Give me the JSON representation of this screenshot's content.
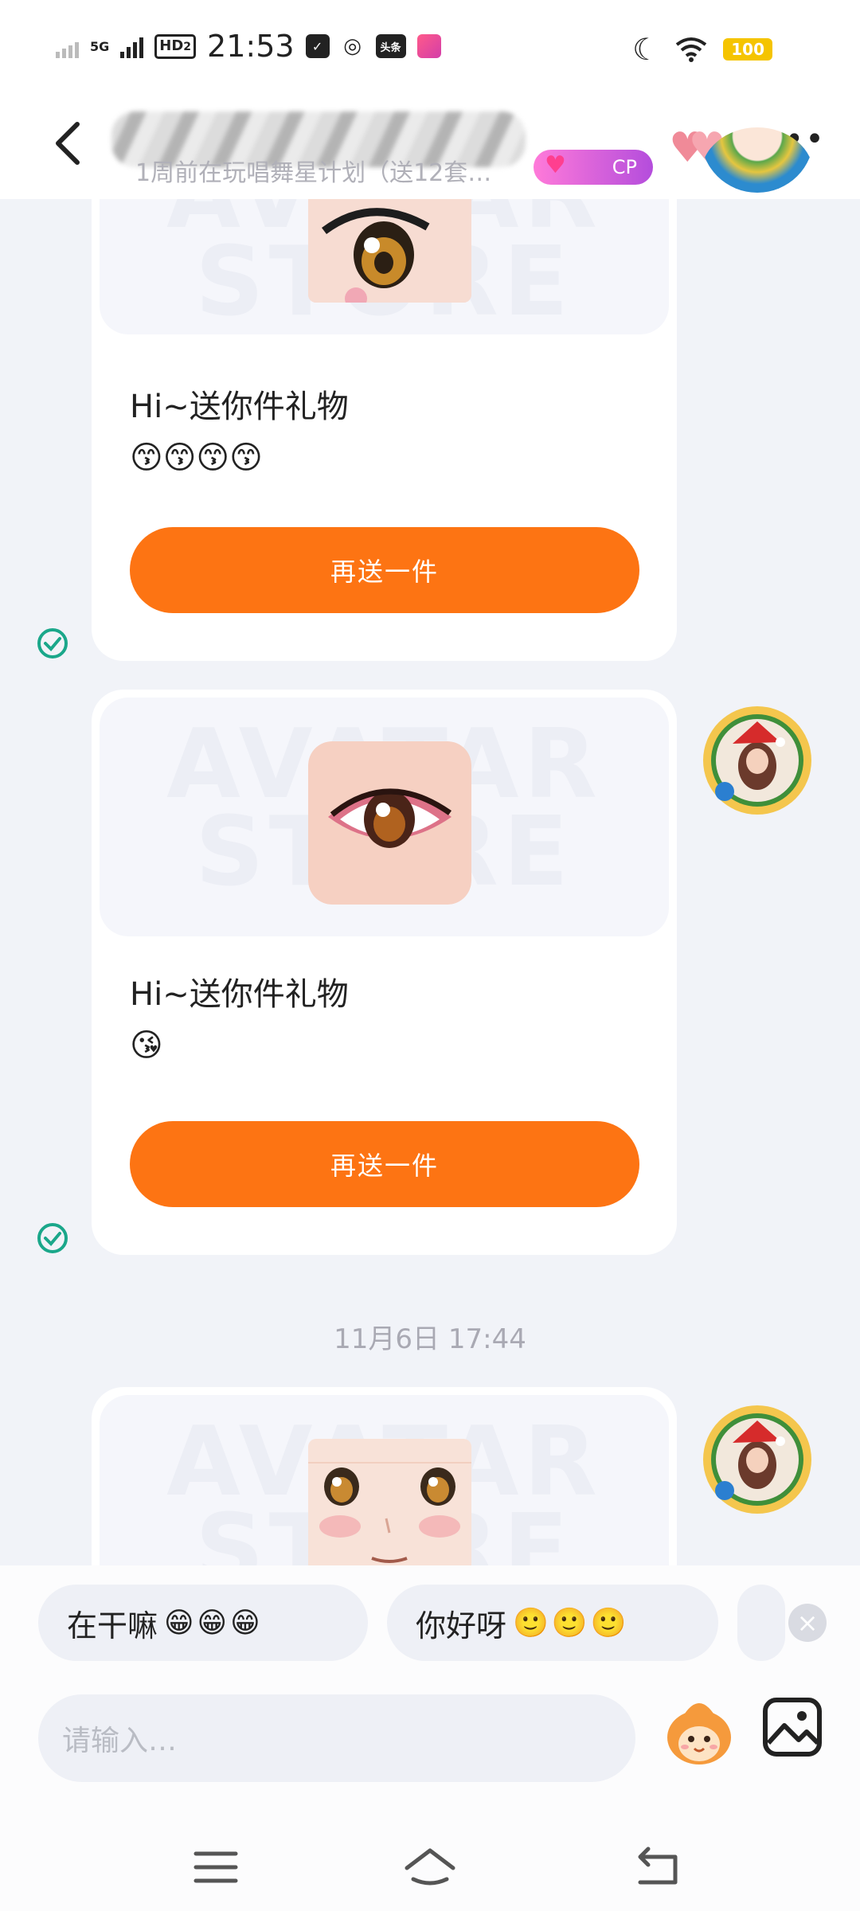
{
  "status_bar": {
    "time": "21:53",
    "network": "5G",
    "hd": "HD",
    "hd_sub": "2",
    "app_badge_1": "头条",
    "battery": "100"
  },
  "header": {
    "subtitle": "1周前在玩唱舞星计划（送12套…",
    "cp_label": "CP",
    "more_icon": "more-dots-icon"
  },
  "messages": [
    {
      "title": "Hi~送你件礼物",
      "emojis": "😙😙😙😙",
      "button": "再送一件",
      "watermark": "AVATAR STORE"
    },
    {
      "title": "Hi~送你件礼物",
      "emojis": "😘",
      "button": "再送一件",
      "watermark": "AVATAR STORE"
    },
    {
      "watermark": "AVATAR STORE"
    }
  ],
  "timestamp": "11月6日 17:44",
  "quick_replies": [
    {
      "text": "在干嘛",
      "faces": "😁😁😁"
    },
    {
      "text": "你好呀",
      "faces": "🙂🙂🙂"
    }
  ],
  "input": {
    "placeholder": "请输入…"
  },
  "colors": {
    "accent": "#fd7413",
    "check": "#1aa78a",
    "background": "#f1f3f8"
  }
}
